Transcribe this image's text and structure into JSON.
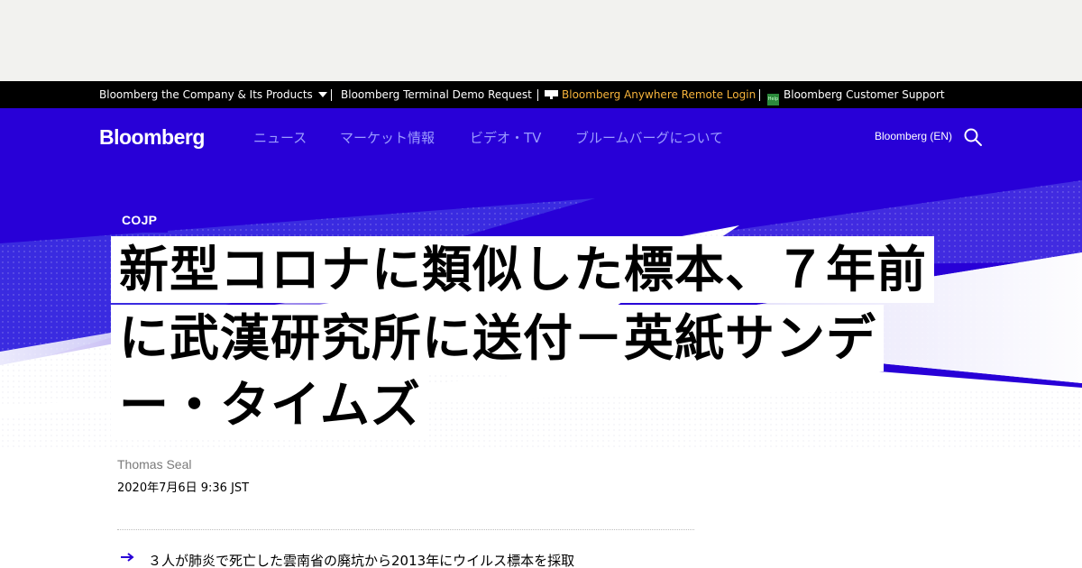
{
  "top_strip": {
    "company_label": "Bloomberg the Company & Its Products",
    "terminal_demo": "Bloomberg Terminal Demo Request",
    "anywhere_login": "Bloomberg Anywhere Remote Login",
    "customer_support": "Bloomberg Customer Support",
    "help_icon_text": "Help",
    "accent_color": "#f7b43b"
  },
  "nav": {
    "logo": "Bloomberg",
    "links": [
      "ニュース",
      "マーケット情報",
      "ビデオ・TV",
      "ブルームバーグについて"
    ],
    "edition": "Bloomberg (EN)",
    "brand_color": "#2800d7"
  },
  "article": {
    "kicker": "COJP",
    "headline_lines": [
      "新型コロナに類似した標本、７年前",
      "に武漢研究所に送付－英紙サンデ",
      "ー・タイムズ"
    ],
    "author": "Thomas Seal",
    "published": "2020年7月6日 9:36 JST",
    "bullets": [
      "３人が肺炎で死亡した雲南省の廃坑から2013年にウイルス標本を採取"
    ]
  }
}
